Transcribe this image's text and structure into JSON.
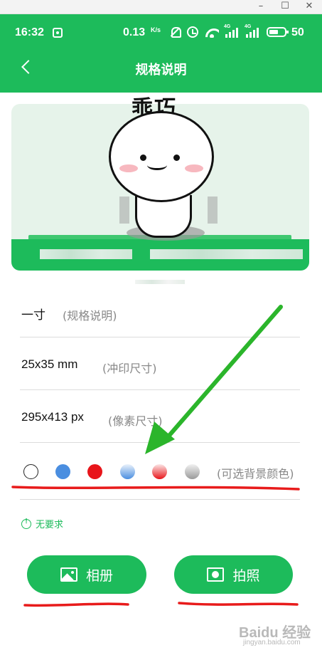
{
  "window": {
    "minimize": "–",
    "maximize": "☐",
    "close": "✕"
  },
  "status_bar": {
    "time": "16:32",
    "network_speed": "0.13",
    "network_speed_unit": "K/s",
    "battery_level": "50",
    "icons": [
      "app-notification-icon",
      "mute-icon",
      "alarm-icon",
      "wifi-icon",
      "signal-4g-icon",
      "signal-4g-icon",
      "battery-icon"
    ],
    "signal_tags": [
      "4G",
      "4G"
    ]
  },
  "header": {
    "title": "规格说明"
  },
  "banner": {
    "sticker_text": "乖巧",
    "accent_color": "#1dbb5b"
  },
  "specs": [
    {
      "value": "一寸",
      "label": "(规格说明)"
    },
    {
      "value": "25x35 mm",
      "label": "(冲印尺寸)"
    },
    {
      "value": "295x413 px",
      "label": "(像素尺寸)"
    }
  ],
  "background_colors": {
    "label": "(可选背景颜色)",
    "swatches": [
      {
        "name": "white",
        "color": "#ffffff"
      },
      {
        "name": "blue",
        "color": "#4a8ee0"
      },
      {
        "name": "red",
        "color": "#e8151a"
      },
      {
        "name": "blue-gradient",
        "color": "#4a8ee0"
      },
      {
        "name": "red-gradient",
        "color": "#e8151a"
      },
      {
        "name": "gray-gradient",
        "color": "#9a9a9a"
      }
    ]
  },
  "hint": {
    "text": "无要求"
  },
  "buttons": {
    "album": "相册",
    "camera": "拍照"
  },
  "watermark": {
    "brand": "Baidu 经验",
    "url": "jingyan.baidu.com"
  },
  "colors": {
    "primary": "#1dbb5b",
    "annotation_arrow": "#2bb52b",
    "annotation_underline": "#e81b1b"
  }
}
